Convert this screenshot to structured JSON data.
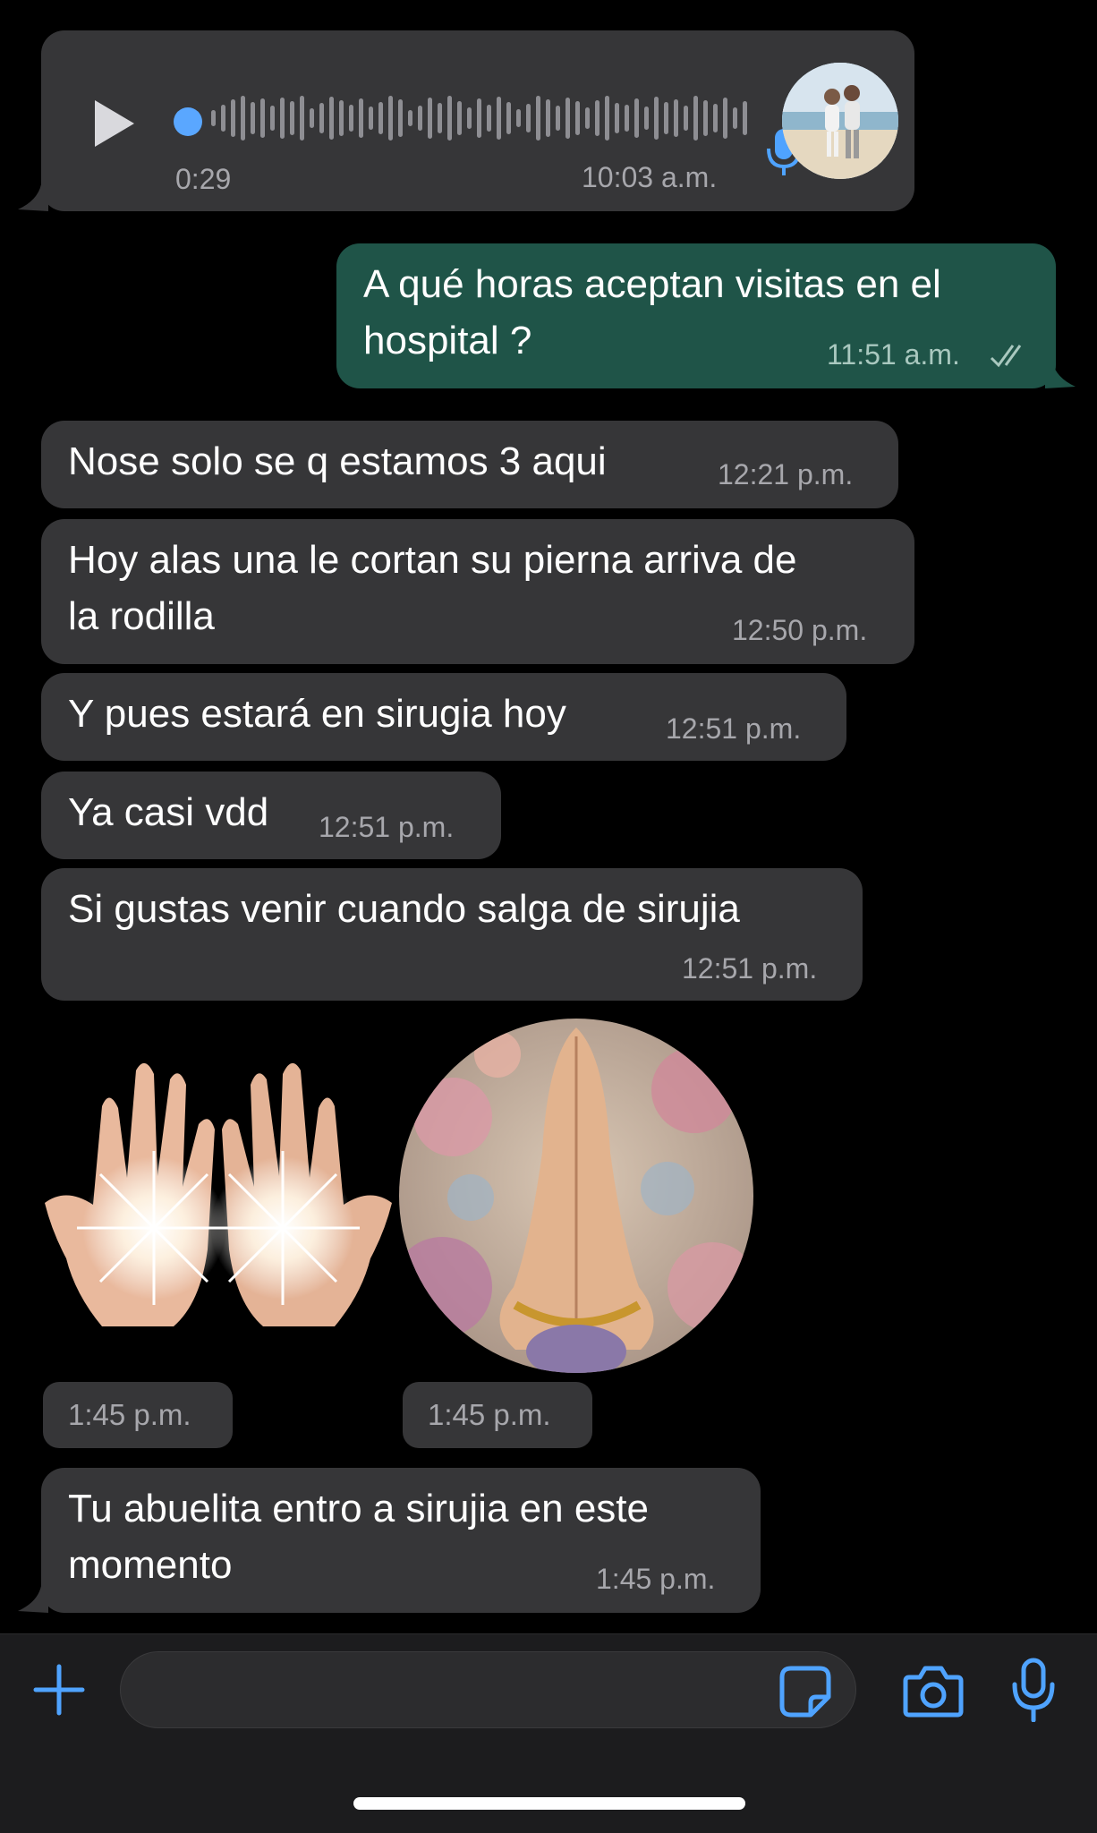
{
  "voice_message": {
    "duration": "0:29",
    "time": "10:03 a.m."
  },
  "messages": [
    {
      "text": "A qué horas aceptan visitas en el\nhospital ?",
      "time": "11:51 a.m."
    },
    {
      "text": "Nose solo se q estamos 3 aqui",
      "time": "12:21 p.m."
    },
    {
      "text": "Hoy alas una le cortan su pierna  arriva de\nla rodilla",
      "time": "12:50 p.m."
    },
    {
      "text": "Y pues estará en sirugia hoy",
      "time": "12:51 p.m."
    },
    {
      "text": "Ya casi vdd",
      "time": "12:51 p.m."
    },
    {
      "text": "Si gustas venir cuando salga de sirujia",
      "time": "12:51 p.m."
    },
    {
      "text": "Tu abuelita entro a sirujia en este\nmomento",
      "time": "1:45 p.m."
    }
  ],
  "stickers": [
    {
      "icon": "glowing-hands-sticker",
      "time": "1:45 p.m."
    },
    {
      "icon": "praying-hands-sticker",
      "time": "1:45 p.m."
    }
  ],
  "colors": {
    "incoming_bubble": "#363638",
    "outgoing_bubble": "#1f5448",
    "accent": "#4fa3ff"
  }
}
